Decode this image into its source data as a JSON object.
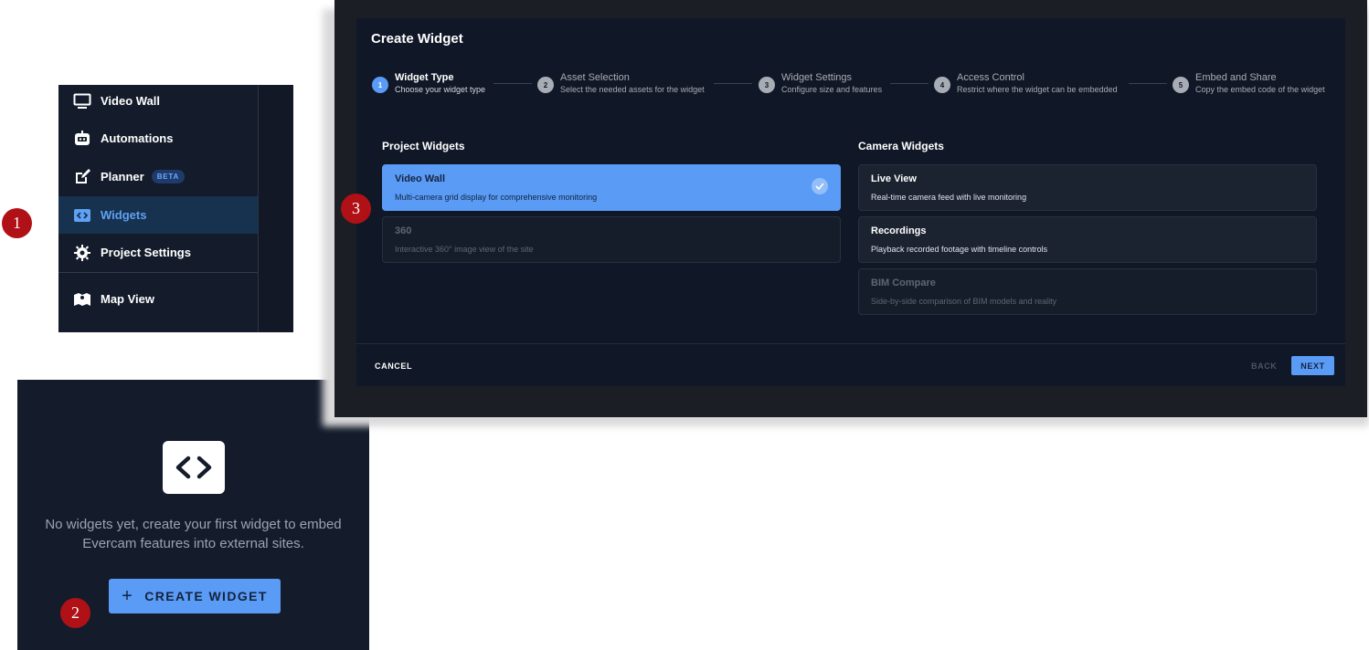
{
  "sidebar": {
    "items": [
      {
        "label": "Video Wall",
        "icon": "monitor-icon"
      },
      {
        "label": "Automations",
        "icon": "automation-icon"
      },
      {
        "label": "Planner",
        "icon": "edit-icon",
        "badge": "BETA"
      },
      {
        "label": "Widgets",
        "icon": "code-icon",
        "active": true
      },
      {
        "label": "Project Settings",
        "icon": "gear-icon"
      },
      {
        "label": "Map View",
        "icon": "map-icon"
      }
    ]
  },
  "empty_state": {
    "message": "No widgets yet, create your first widget to embed Evercam features into external sites.",
    "button_label": "CREATE WIDGET",
    "button_icon": "plus-icon",
    "illustration_icon": "code-icon"
  },
  "dialog": {
    "title": "Create Widget",
    "steps": [
      {
        "number": "1",
        "title": "Widget Type",
        "subtitle": "Choose your widget type",
        "active": true
      },
      {
        "number": "2",
        "title": "Asset Selection",
        "subtitle": "Select the needed assets for the widget"
      },
      {
        "number": "3",
        "title": "Widget Settings",
        "subtitle": "Configure size and features"
      },
      {
        "number": "4",
        "title": "Access Control",
        "subtitle": "Restrict where the widget can be embedded"
      },
      {
        "number": "5",
        "title": "Embed and Share",
        "subtitle": "Copy the embed code of the widget"
      }
    ],
    "project_widgets": {
      "heading": "Project Widgets",
      "cards": [
        {
          "title": "Video Wall",
          "description": "Multi-camera grid display for comprehensive monitoring",
          "state": "selected"
        },
        {
          "title": "360",
          "description": "Interactive 360° image view of the site",
          "state": "disabled"
        }
      ]
    },
    "camera_widgets": {
      "heading": "Camera Widgets",
      "cards": [
        {
          "title": "Live View",
          "description": "Real-time camera feed with live monitoring",
          "state": "normal"
        },
        {
          "title": "Recordings",
          "description": "Playback recorded footage with timeline controls",
          "state": "normal"
        },
        {
          "title": "BIM Compare",
          "description": "Side-by-side comparison of BIM models and reality",
          "state": "disabled"
        }
      ]
    },
    "footer": {
      "cancel": "CANCEL",
      "back": "BACK",
      "next": "NEXT"
    }
  },
  "markers": [
    "1",
    "2",
    "3"
  ],
  "colors": {
    "accent": "#5a9bf6",
    "background": "#141c2b",
    "marker": "#b01116"
  }
}
